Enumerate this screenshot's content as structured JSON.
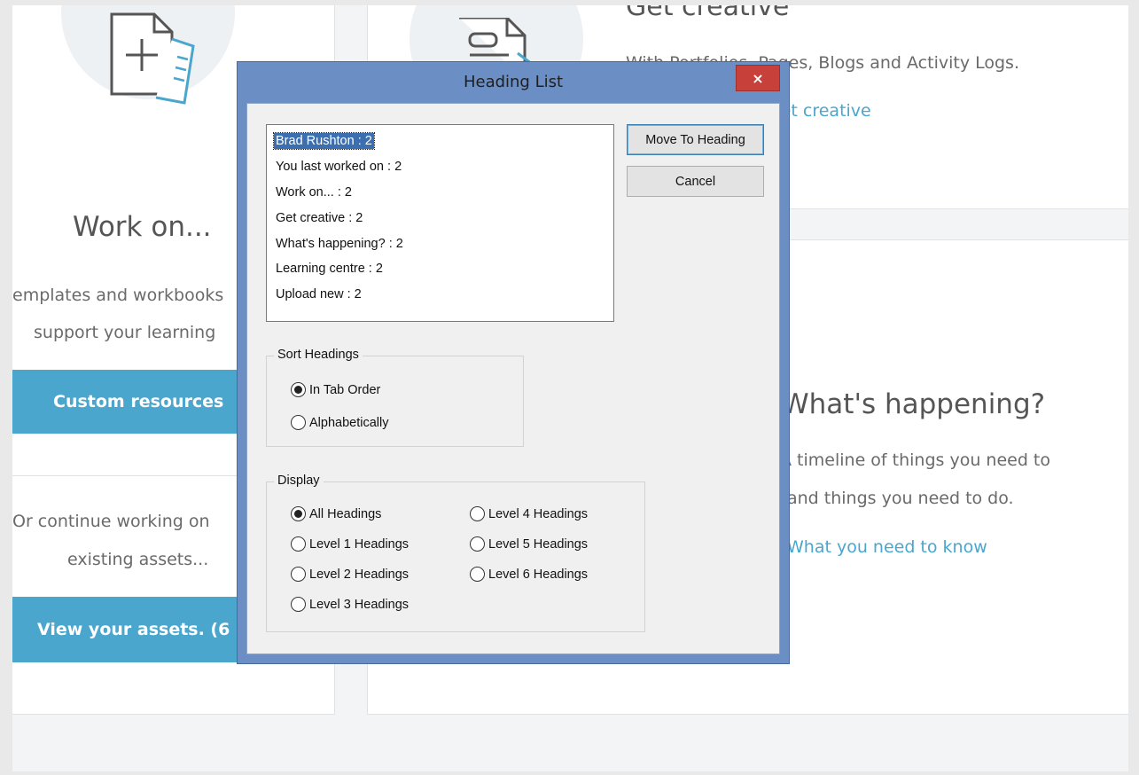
{
  "background": {
    "work_on_title": "Work on...",
    "work_on_line1": "emplates and workbooks",
    "work_on_line2": "support your learning",
    "custom_resources_label": "Custom resources",
    "or_continue_line1": "Or continue working on",
    "or_continue_line2": "existing assets...",
    "view_assets_label": "View your assets. (6",
    "get_creative_title": "Get creative",
    "get_creative_desc": "With Portfolios, Pages, Blogs and Activity Logs.",
    "get_creative_link": "Get creative",
    "whats_happening_title": "What's happening?",
    "whats_happening_line1": "A timeline of things you need to",
    "whats_happening_line2": "and things you need to do.",
    "whats_happening_link": "What you need to know",
    "accent_color": "#4aa6cd"
  },
  "dialog": {
    "title": "Heading List",
    "close_label": "×",
    "headings": [
      {
        "label": "Brad Rushton : 2",
        "selected": true
      },
      {
        "label": "You last worked on : 2",
        "selected": false
      },
      {
        "label": "Work on... : 2",
        "selected": false
      },
      {
        "label": "Get creative : 2",
        "selected": false
      },
      {
        "label": "What's happening? : 2",
        "selected": false
      },
      {
        "label": "Learning centre : 2",
        "selected": false
      },
      {
        "label": "Upload new : 2",
        "selected": false
      }
    ],
    "move_to_heading_label": "Move To Heading",
    "cancel_label": "Cancel",
    "sort": {
      "label": "Sort Headings",
      "options": [
        {
          "label": "In Tab Order",
          "checked": true
        },
        {
          "label": "Alphabetically",
          "checked": false
        }
      ]
    },
    "display": {
      "label": "Display",
      "options": [
        {
          "label": "All Headings",
          "checked": true
        },
        {
          "label": "Level 1 Headings",
          "checked": false
        },
        {
          "label": "Level 2 Headings",
          "checked": false
        },
        {
          "label": "Level 3 Headings",
          "checked": false
        },
        {
          "label": "Level 4 Headings",
          "checked": false
        },
        {
          "label": "Level 5 Headings",
          "checked": false
        },
        {
          "label": "Level 6 Headings",
          "checked": false
        }
      ]
    }
  }
}
